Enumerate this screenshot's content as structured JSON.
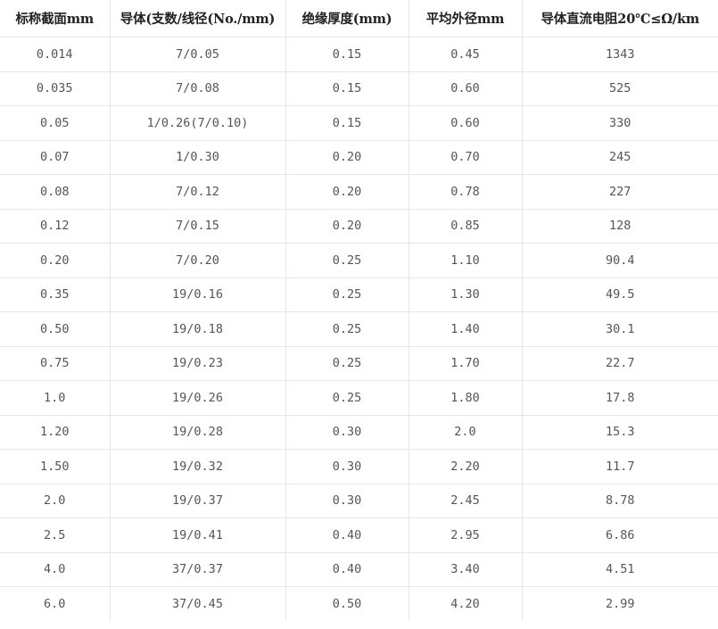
{
  "table": {
    "headers": [
      "标称截面mm",
      "导体(支数/线径(No./mm)",
      "绝缘厚度(mm)",
      "平均外径mm",
      "导体直流电阻20℃≤Ω/km"
    ],
    "rows": [
      [
        "0.014",
        "7/0.05",
        "0.15",
        "0.45",
        "1343"
      ],
      [
        "0.035",
        "7/0.08",
        "0.15",
        "0.60",
        "525"
      ],
      [
        "0.05",
        "1/0.26(7/0.10)",
        "0.15",
        "0.60",
        "330"
      ],
      [
        "0.07",
        "1/0.30",
        "0.20",
        "0.70",
        "245"
      ],
      [
        "0.08",
        "7/0.12",
        "0.20",
        "0.78",
        "227"
      ],
      [
        "0.12",
        "7/0.15",
        "0.20",
        "0.85",
        "128"
      ],
      [
        "0.20",
        "7/0.20",
        "0.25",
        "1.10",
        "90.4"
      ],
      [
        "0.35",
        "19/0.16",
        "0.25",
        "1.30",
        "49.5"
      ],
      [
        "0.50",
        "19/0.18",
        "0.25",
        "1.40",
        "30.1"
      ],
      [
        "0.75",
        "19/0.23",
        "0.25",
        "1.70",
        "22.7"
      ],
      [
        "1.0",
        "19/0.26",
        "0.25",
        "1.80",
        "17.8"
      ],
      [
        "1.20",
        "19/0.28",
        "0.30",
        "2.0",
        "15.3"
      ],
      [
        "1.50",
        "19/0.32",
        "0.30",
        "2.20",
        "11.7"
      ],
      [
        "2.0",
        "19/0.37",
        "0.30",
        "2.45",
        "8.78"
      ],
      [
        "2.5",
        "19/0.41",
        "0.40",
        "2.95",
        "6.86"
      ],
      [
        "4.0",
        "37/0.37",
        "0.40",
        "3.40",
        "4.51"
      ],
      [
        "6.0",
        "37/0.45",
        "0.50",
        "4.20",
        "2.99"
      ]
    ]
  }
}
